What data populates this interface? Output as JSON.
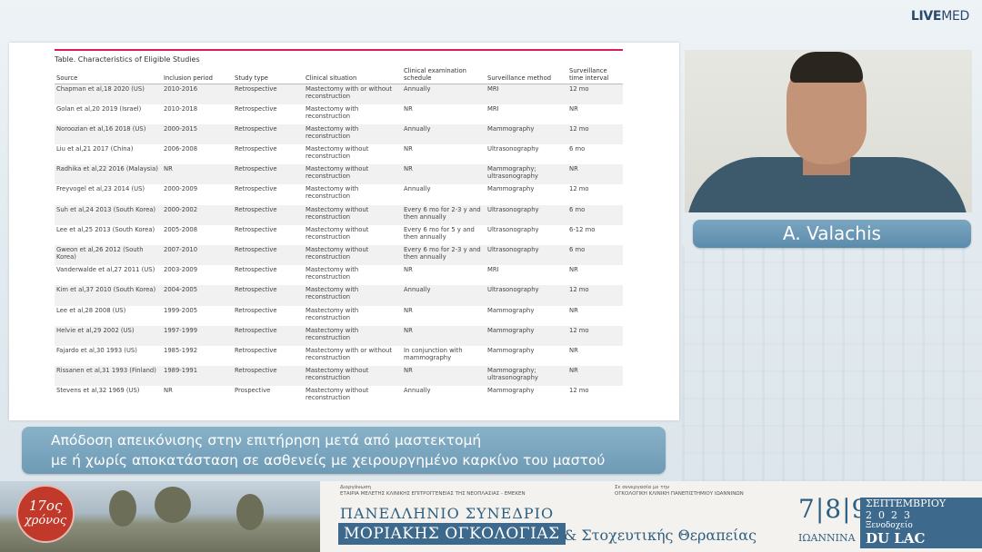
{
  "brand": {
    "live": "LIVE",
    "med": "MED"
  },
  "slide": {
    "title": "Table. Characteristics of Eligible Studies",
    "columns": [
      "Source",
      "Inclusion period",
      "Study type",
      "Clinical situation",
      "Clinical examination schedule",
      "Surveillance method",
      "Surveillance time interval"
    ],
    "rows": [
      [
        "Chapman et al,18 2020 (US)",
        "2010-2016",
        "Retrospective",
        "Mastectomy with or without reconstruction",
        "Annually",
        "MRI",
        "12 mo"
      ],
      [
        "Golan et al,20 2019 (Israel)",
        "2010-2018",
        "Retrospective",
        "Mastectomy with reconstruction",
        "NR",
        "MRI",
        "NR"
      ],
      [
        "Noroozian et al,16 2018 (US)",
        "2000-2015",
        "Retrospective",
        "Mastectomy with reconstruction",
        "Annually",
        "Mammography",
        "12 mo"
      ],
      [
        "Liu et al,21 2017 (China)",
        "2006-2008",
        "Retrospective",
        "Mastectomy without reconstruction",
        "NR",
        "Ultrasonography",
        "6 mo"
      ],
      [
        "Radhika et al,22 2016 (Malaysia)",
        "NR",
        "Retrospective",
        "Mastectomy without reconstruction",
        "NR",
        "Mammography; ultrasonography",
        "NR"
      ],
      [
        "Freyvogel et al,23 2014 (US)",
        "2000-2009",
        "Retrospective",
        "Mastectomy with reconstruction",
        "Annually",
        "Mammography",
        "12 mo"
      ],
      [
        "Suh et al,24 2013 (South Korea)",
        "2000-2002",
        "Retrospective",
        "Mastectomy without reconstruction",
        "Every 6 mo for 2-3 y and then annually",
        "Ultrasonography",
        "6 mo"
      ],
      [
        "Lee et al,25 2013 (South Korea)",
        "2005-2008",
        "Retrospective",
        "Mastectomy without reconstruction",
        "Every 6 mo for 5 y and then annually",
        "Ultrasonography",
        "6-12 mo"
      ],
      [
        "Gweon et al,26 2012 (South Korea)",
        "2007-2010",
        "Retrospective",
        "Mastectomy without reconstruction",
        "Every 6 mo for 2-3 y and then annually",
        "Ultrasonography",
        "6 mo"
      ],
      [
        "Vanderwalde et al,27 2011 (US)",
        "2003-2009",
        "Retrospective",
        "Mastectomy with reconstruction",
        "NR",
        "MRI",
        "NR"
      ],
      [
        "Kim et al,37 2010 (South Korea)",
        "2004-2005",
        "Retrospective",
        "Mastectomy with reconstruction",
        "Annually",
        "Ultrasonography",
        "12 mo"
      ],
      [
        "Lee et al,28 2008 (US)",
        "1999-2005",
        "Retrospective",
        "Mastectomy with reconstruction",
        "NR",
        "Mammography",
        "NR"
      ],
      [
        "Helvie et al,29 2002 (US)",
        "1997-1999",
        "Retrospective",
        "Mastectomy with reconstruction",
        "NR",
        "Mammography",
        "12 mo"
      ],
      [
        "Fajardo et al,30 1993 (US)",
        "1985-1992",
        "Retrospective",
        "Mastectomy with or without reconstruction",
        "In conjunction with mammography",
        "Mammography",
        "NR"
      ],
      [
        "Rissanen et al,31 1993 (Finland)",
        "1989-1991",
        "Retrospective",
        "Mastectomy without reconstruction",
        "NR",
        "Mammography; ultrasonography",
        "NR"
      ],
      [
        "Stevens et al,32 1969 (US)",
        "NR",
        "Prospective",
        "Mastectomy without reconstruction",
        "Annually",
        "Mammography",
        "12 mo"
      ]
    ]
  },
  "speaker": {
    "name": "A. Valachis"
  },
  "caption": {
    "line1": "Απόδοση απεικόνισης στην επιτήρηση μετά από μαστεκτομή",
    "line2": "με ή χωρίς αποκατάσταση σε ασθενείς με χειρουργημένο καρκίνο του μαστού"
  },
  "footer": {
    "badge_number": "17ος",
    "badge_word": "χρόνος",
    "org_left_label": "Διοργάνωση",
    "org_left": "ΕΤΑΙΡΙΑ ΜΕΛΕΤΗΣ ΚΛΙΝΙΚΗΣ ΕΠΙΤΡΟΓΓΕΝΕΙΑΣ ΤΗΣ ΝΕΟΠΛΑΣΙΑΣ - ΕΜΕΚΕΝ",
    "org_right_label": "Σε συνεργασία με την",
    "org_right": "ΟΓΚΟΛΟΓΙΚΗ ΚΛΙΝΙΚΗ ΠΑΝΕΠΙΣΤΗΜΙΟΥ ΙΩΑΝΝΙΝΩΝ",
    "conf_line1": "ΠΑΝΕΛΛΗΝΙΟ ΣΥΝΕΔΡΙΟ",
    "conf_line2": "ΜΟΡΙΑΚΗΣ ΟΓΚΟΛΟΓΙΑΣ",
    "conf_line3": "& Στοχευτικής Θεραπείας",
    "dates": "7|8|9",
    "city": "ΙΩΑΝΝΙΝΑ",
    "month": "ΣΕΠΤΕΜΒΡΙΟΥ",
    "year": "2023",
    "hotel": "Ξενοδοχείο",
    "hotel_name": "DU LAC"
  }
}
